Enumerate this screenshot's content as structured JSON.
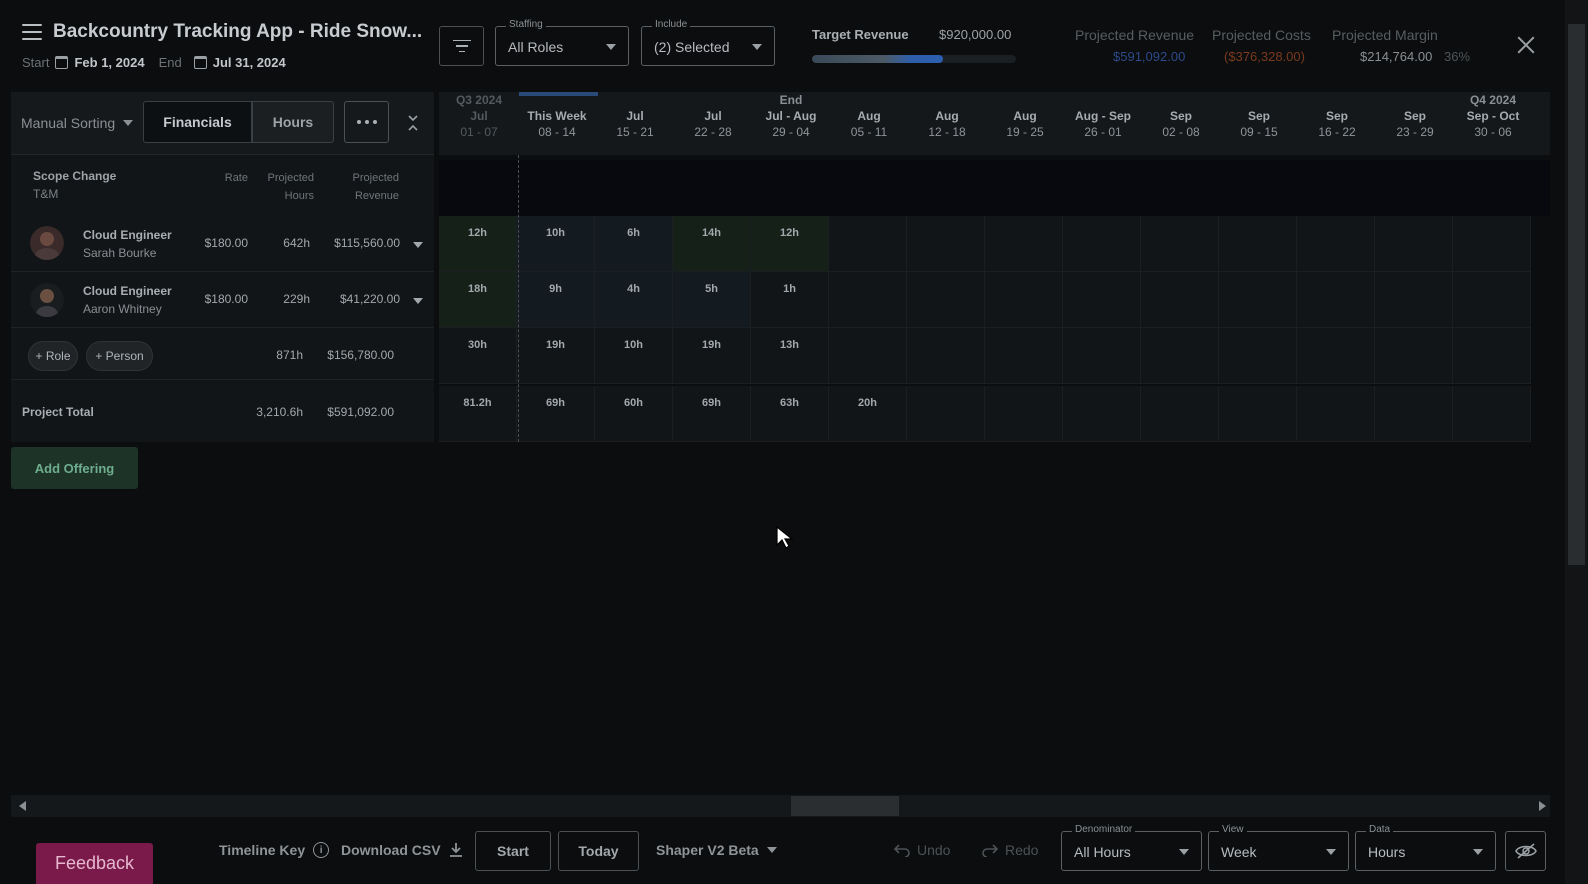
{
  "header": {
    "title": "Backcountry Tracking App - Ride Snow...",
    "start_label": "Start",
    "start_date": "Feb 1, 2024",
    "end_label": "End",
    "end_date": "Jul 31, 2024"
  },
  "filters": {
    "staffing": {
      "legend": "Staffing",
      "value": "All Roles"
    },
    "include": {
      "legend": "Include",
      "value": "(2) Selected"
    }
  },
  "target_revenue": {
    "label": "Target Revenue",
    "value": "$920,000.00",
    "progress": 0.64
  },
  "kpis": {
    "projected_revenue": {
      "label": "Projected Revenue",
      "value": "$591,092.00",
      "color": "#2d4a8a"
    },
    "projected_costs": {
      "label": "Projected Costs",
      "value": "($376,328.00)",
      "color": "#7a3a1e"
    },
    "projected_margin": {
      "label": "Projected Margin",
      "value": "$214,764.00",
      "percent": "36%",
      "color": "#8a8f93"
    }
  },
  "toolbar": {
    "sorting": "Manual Sorting",
    "financials": "Financials",
    "hours": "Hours"
  },
  "table_header": {
    "scope": "Scope Change",
    "billing": "T&M",
    "rate": "Rate",
    "projected_hours_1": "Projected",
    "projected_hours_2": "Hours",
    "projected_revenue_1": "Projected",
    "projected_revenue_2": "Revenue"
  },
  "rows": [
    {
      "role": "Cloud Engineer",
      "person": "Sarah Bourke",
      "rate": "$180.00",
      "hours": "642h",
      "revenue": "$115,560.00"
    },
    {
      "role": "Cloud Engineer",
      "person": "Aaron Whitney",
      "rate": "$180.00",
      "hours": "229h",
      "revenue": "$41,220.00"
    }
  ],
  "subtotal": {
    "add_role": "+ Role",
    "add_person": "+ Person",
    "hours": "871h",
    "revenue": "$156,780.00"
  },
  "project_total": {
    "label": "Project Total",
    "hours": "3,210.6h",
    "revenue": "$591,092.00"
  },
  "add_offering": "Add Offering",
  "weeks": [
    {
      "q": "Q3 2024",
      "m": "Jul",
      "d": "01 - 07"
    },
    {
      "q": "",
      "m": "This Week",
      "d": "08 - 14"
    },
    {
      "q": "",
      "m": "Jul",
      "d": "15 - 21"
    },
    {
      "q": "",
      "m": "Jul",
      "d": "22 - 28"
    },
    {
      "q": "End",
      "m": "Jul - Aug",
      "d": "29 - 04"
    },
    {
      "q": "",
      "m": "Aug",
      "d": "05 - 11"
    },
    {
      "q": "",
      "m": "Aug",
      "d": "12 - 18"
    },
    {
      "q": "",
      "m": "Aug",
      "d": "19 - 25"
    },
    {
      "q": "",
      "m": "Aug - Sep",
      "d": "26 - 01"
    },
    {
      "q": "",
      "m": "Sep",
      "d": "02 - 08"
    },
    {
      "q": "",
      "m": "Sep",
      "d": "09 - 15"
    },
    {
      "q": "",
      "m": "Sep",
      "d": "16 - 22"
    },
    {
      "q": "",
      "m": "Sep",
      "d": "23 - 29"
    },
    {
      "q": "Q4 2024",
      "m": "Sep - Oct",
      "d": "30 - 06"
    }
  ],
  "grid": {
    "row1": [
      "12h",
      "10h",
      "6h",
      "14h",
      "12h",
      "",
      "",
      "",
      "",
      "",
      "",
      "",
      "",
      ""
    ],
    "row2": [
      "18h",
      "9h",
      "4h",
      "5h",
      "1h",
      "",
      "",
      "",
      "",
      "",
      "",
      "",
      "",
      ""
    ],
    "subtotal": [
      "30h",
      "19h",
      "10h",
      "19h",
      "13h",
      "",
      "",
      "",
      "",
      "",
      "",
      "",
      "",
      ""
    ],
    "total": [
      "81.2h",
      "69h",
      "60h",
      "69h",
      "63h",
      "20h",
      "",
      "",
      "",
      "",
      "",
      "",
      "",
      ""
    ]
  },
  "footer": {
    "feedback": "Feedback",
    "timeline_key": "Timeline Key",
    "download_csv": "Download CSV",
    "start": "Start",
    "today": "Today",
    "shaper": "Shaper V2 Beta",
    "undo": "Undo",
    "redo": "Redo",
    "denominator": {
      "legend": "Denominator",
      "value": "All Hours"
    },
    "view": {
      "legend": "View",
      "value": "Week"
    },
    "data": {
      "legend": "Data",
      "value": "Hours"
    }
  }
}
